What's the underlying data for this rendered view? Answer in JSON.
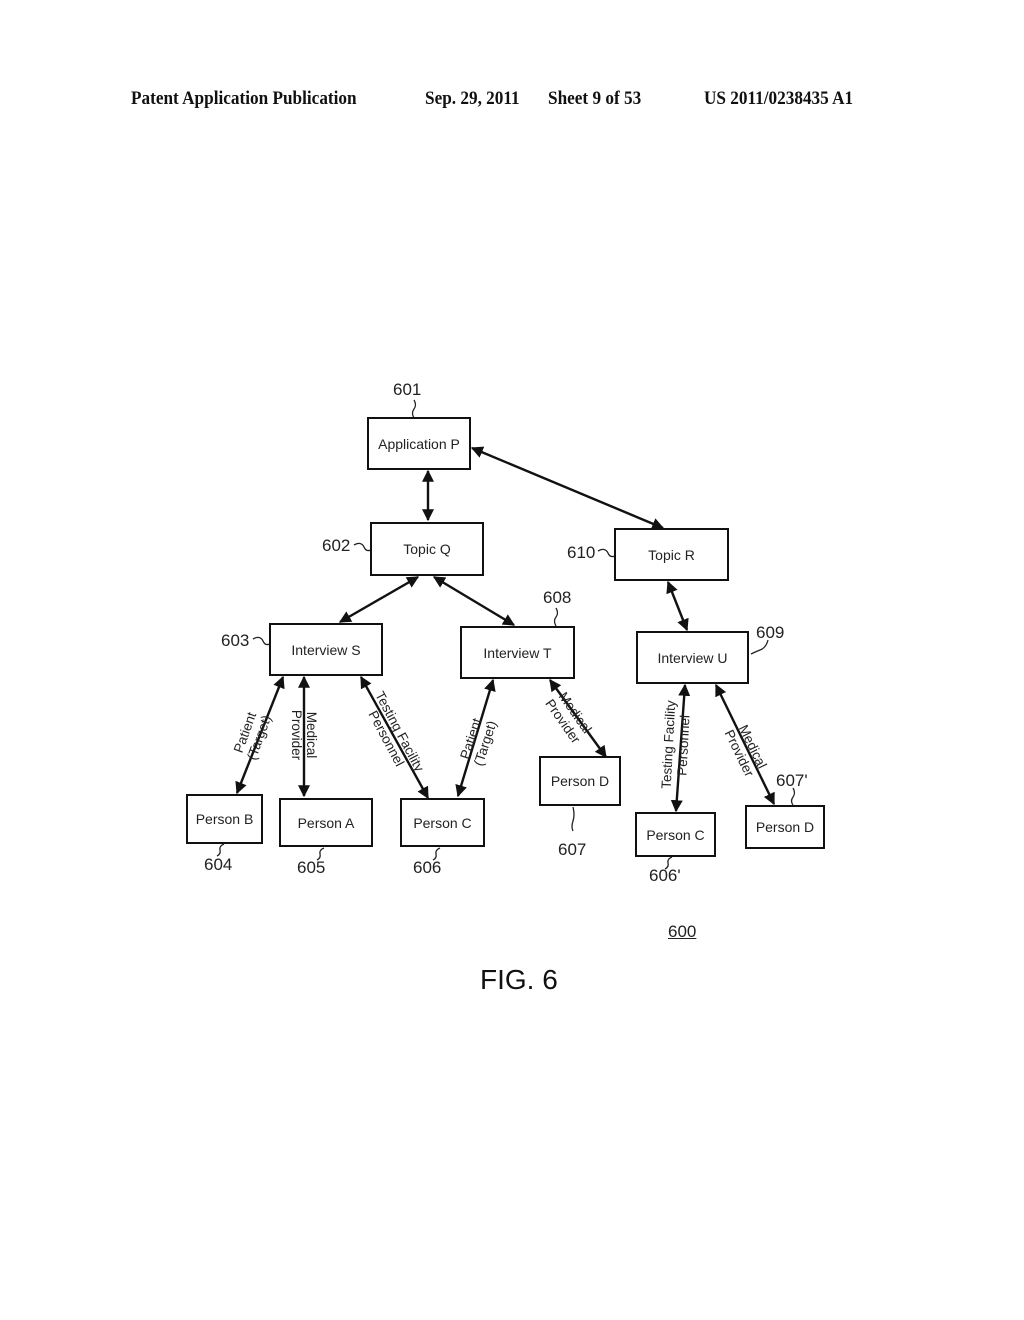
{
  "header": {
    "publication": "Patent Application Publication",
    "date": "Sep. 29, 2011",
    "sheet": "Sheet 9 of 53",
    "number": "US 2011/0238435 A1"
  },
  "diagram": {
    "nodes": {
      "application_p": {
        "label": "Application P",
        "ref": "601"
      },
      "topic_q": {
        "label": "Topic Q",
        "ref": "602"
      },
      "topic_r": {
        "label": "Topic R",
        "ref": "610"
      },
      "interview_s": {
        "label": "Interview S",
        "ref": "603"
      },
      "interview_t": {
        "label": "Interview T",
        "ref": "608"
      },
      "interview_u": {
        "label": "Interview U",
        "ref": "609"
      },
      "person_b": {
        "label": "Person B",
        "ref": "604"
      },
      "person_a": {
        "label": "Person A",
        "ref": "605"
      },
      "person_c": {
        "label": "Person C",
        "ref": "606"
      },
      "person_d": {
        "label": "Person D",
        "ref": "607"
      },
      "person_c2": {
        "label": "Person C",
        "ref": "606'"
      },
      "person_d2": {
        "label": "Person D",
        "ref": "607'"
      }
    },
    "edges": [
      {
        "from": "application_p",
        "to": "topic_q",
        "label": ""
      },
      {
        "from": "application_p",
        "to": "topic_r",
        "label": ""
      },
      {
        "from": "topic_q",
        "to": "interview_s",
        "label": ""
      },
      {
        "from": "topic_q",
        "to": "interview_t",
        "label": ""
      },
      {
        "from": "topic_r",
        "to": "interview_u",
        "label": ""
      },
      {
        "from": "interview_s",
        "to": "person_b",
        "label": "Patient (Target)",
        "line1": "Patient",
        "line2": "(Target)"
      },
      {
        "from": "interview_s",
        "to": "person_a",
        "label": "Medical Provider",
        "line1": "Medical",
        "line2": "Provider"
      },
      {
        "from": "interview_s",
        "to": "person_c",
        "label": "Testing Facility Personnel",
        "line1": "Testing Facility",
        "line2": "Personnel"
      },
      {
        "from": "interview_t",
        "to": "person_c",
        "label": "Patient (Target)",
        "line1": "Patient",
        "line2": "(Target)"
      },
      {
        "from": "interview_t",
        "to": "person_d",
        "label": "Medical Provider",
        "line1": "Medical",
        "line2": "Provider"
      },
      {
        "from": "interview_u",
        "to": "person_c2",
        "label": "Testing Facility Personnel",
        "line1": "Testing Facility",
        "line2": "Personnel"
      },
      {
        "from": "interview_u",
        "to": "person_d2",
        "label": "Medical Provider",
        "line1": "Medical",
        "line2": "Provider"
      }
    ],
    "figure_ref": "600",
    "figure_caption": "FIG. 6"
  }
}
